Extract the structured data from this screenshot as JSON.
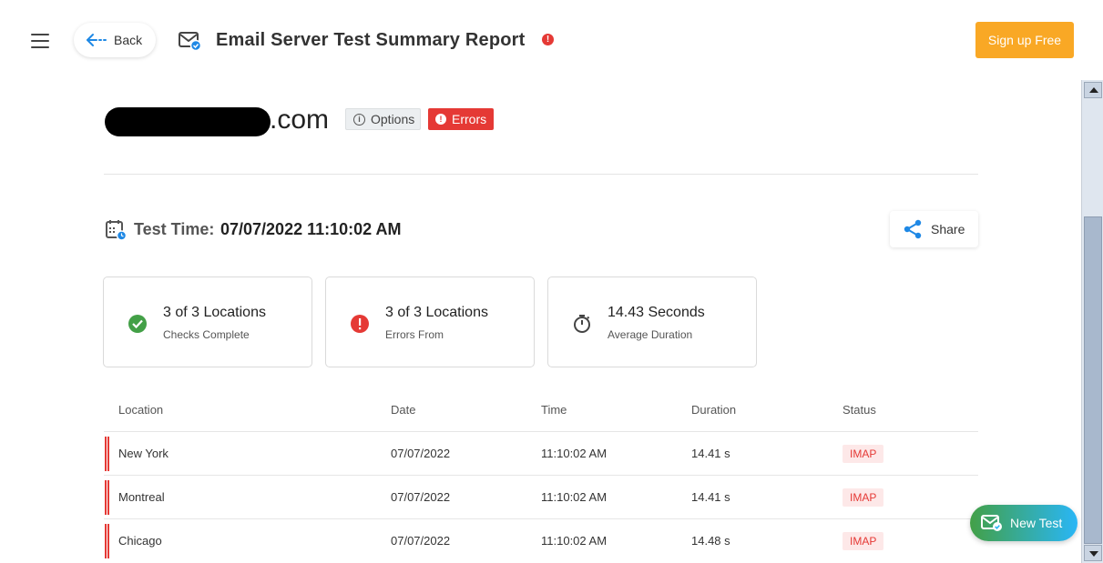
{
  "header": {
    "back_label": "Back",
    "title": "Email Server Test Summary Report",
    "signup_label": "Sign up Free"
  },
  "domain": {
    "suffix": ".com",
    "options_label": "Options",
    "errors_label": "Errors"
  },
  "test_time": {
    "label": "Test Time:",
    "value": "07/07/2022 11:10:02 AM",
    "share_label": "Share"
  },
  "cards": [
    {
      "main": "3 of 3 Locations",
      "sub": "Checks Complete",
      "icon": "check-circle-icon"
    },
    {
      "main": "3 of 3 Locations",
      "sub": "Errors From",
      "icon": "error-circle-icon"
    },
    {
      "main": "14.43 Seconds",
      "sub": "Average Duration",
      "icon": "stopwatch-icon"
    }
  ],
  "table": {
    "headers": [
      "Location",
      "Date",
      "Time",
      "Duration",
      "Status"
    ],
    "rows": [
      {
        "location": "New York",
        "date": "07/07/2022",
        "time": "11:10:02 AM",
        "duration": "14.41 s",
        "status": "IMAP"
      },
      {
        "location": "Montreal",
        "date": "07/07/2022",
        "time": "11:10:02 AM",
        "duration": "14.41 s",
        "status": "IMAP"
      },
      {
        "location": "Chicago",
        "date": "07/07/2022",
        "time": "11:10:02 AM",
        "duration": "14.48 s",
        "status": "IMAP"
      }
    ]
  },
  "fab": {
    "new_test_label": "New Test"
  },
  "colors": {
    "accent_orange": "#f9a825",
    "error_red": "#e53935",
    "success_green": "#43a047",
    "link_blue": "#1e88e5"
  }
}
